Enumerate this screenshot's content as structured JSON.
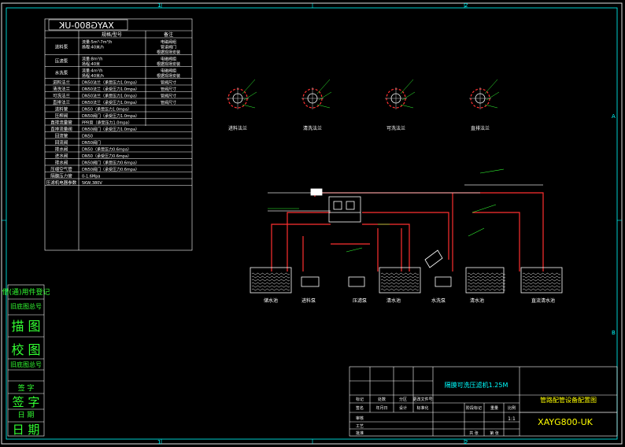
{
  "border": {
    "col_marks": [
      "1",
      "2"
    ],
    "row_marks": [
      "A",
      "B"
    ]
  },
  "spec_table": {
    "title": "XAYG800-UK",
    "headers": [
      "规格/型号",
      "备注"
    ],
    "rows": [
      {
        "name": "进料泵",
        "spec": [
          "流量:5m³-7m³/h",
          "扬程:40米/h"
        ],
        "note": [
          "电磁阀组",
          "管道阀门",
          "根据现场安装"
        ]
      },
      {
        "name": "压滤泵",
        "spec": [
          "流量:8m³/h",
          "扬程:40米"
        ],
        "note": [
          "电磁阀组",
          "根据现场安装"
        ]
      },
      {
        "name": "水洗泵",
        "spec": [
          "流量:4m³/h",
          "扬程:40米/h"
        ],
        "note": [
          "电磁阀组",
          "根据现场安装"
        ]
      },
      {
        "name": "进料法兰",
        "spec": [
          "DN50法兰（承受压力1.0mpa）"
        ],
        "note": [
          "管阀尺寸"
        ]
      },
      {
        "name": "清洗法兰",
        "spec": [
          "DN50法兰（承受压力1.0mpa）"
        ],
        "note": [
          "管阀尺寸"
        ]
      },
      {
        "name": "可洗法兰",
        "spec": [
          "DN50法兰（承受压力1.0mpa）"
        ],
        "note": [
          "管阀尺寸"
        ]
      },
      {
        "name": "直排法兰",
        "spec": [
          "DN50法兰（承受压力1.0mpa）"
        ],
        "note": [
          "管阀尺寸"
        ]
      },
      {
        "name": "进料管",
        "spec": [
          "DN50（承受压力1.0mpa）"
        ],
        "note": []
      },
      {
        "name": "压榨阀",
        "spec": [
          "DN50阀门（承受压力1.0mpa）"
        ],
        "note": []
      },
      {
        "name": "直排流量管",
        "spec": [
          "PPR管（承受压力1.0mpa）"
        ],
        "note": []
      },
      {
        "name": "直排流量阀",
        "spec": [
          "DN50阀门（承受压力1.0mpa）"
        ],
        "note": []
      },
      {
        "name": "回流管",
        "spec": [
          "DN50"
        ],
        "note": []
      },
      {
        "name": "回流阀",
        "spec": [
          "DN50阀门"
        ],
        "note": []
      },
      {
        "name": "排水阀",
        "spec": [
          "DN50（承受压力0.6mpa）"
        ],
        "note": []
      },
      {
        "name": "进水阀",
        "spec": [
          "DN50（承受压力0.6mpa）"
        ],
        "note": []
      },
      {
        "name": "排水阀",
        "spec": [
          "DN50阀门（承受压力0.6mpa）"
        ],
        "note": []
      },
      {
        "name": "压缩空气管",
        "spec": [
          "DN50阀门（承受压力0.6mpa）"
        ],
        "note": []
      },
      {
        "name": "隔膜压力管",
        "spec": [
          "0-1.6Mpa"
        ],
        "note": []
      },
      {
        "name": "压滤机电器参数",
        "spec": [
          "5KW,380V"
        ],
        "note": []
      }
    ]
  },
  "left_stamps": [
    "借(通)用件登记",
    "旧底图总号",
    "描 图",
    "校 图",
    "旧底图总号",
    "签 字",
    "日 期",
    "签 字",
    "日 期"
  ],
  "flanges": [
    {
      "label": "进料法兰"
    },
    {
      "label": "清洗法兰"
    },
    {
      "label": "可洗法兰"
    },
    {
      "label": "直排法兰"
    }
  ],
  "tank_labels": [
    "储水池",
    "进料泵",
    "压滤泵",
    "清水池",
    "水洗泵",
    "清水池",
    "直流清水池"
  ],
  "title_block": {
    "machine": "隔膜可洗压滤机1.25M",
    "drawing": "管路配管设备配置图",
    "code": "XAYG800-UK",
    "rows": [
      "标记",
      "处数",
      "分区",
      "更改文件号",
      "签名",
      "年月日",
      "设计",
      "标准化",
      "阶段标记",
      "重量",
      "比例",
      "审核",
      "工艺",
      "批准",
      "共 张",
      "第 张"
    ],
    "scale": "1:1"
  }
}
